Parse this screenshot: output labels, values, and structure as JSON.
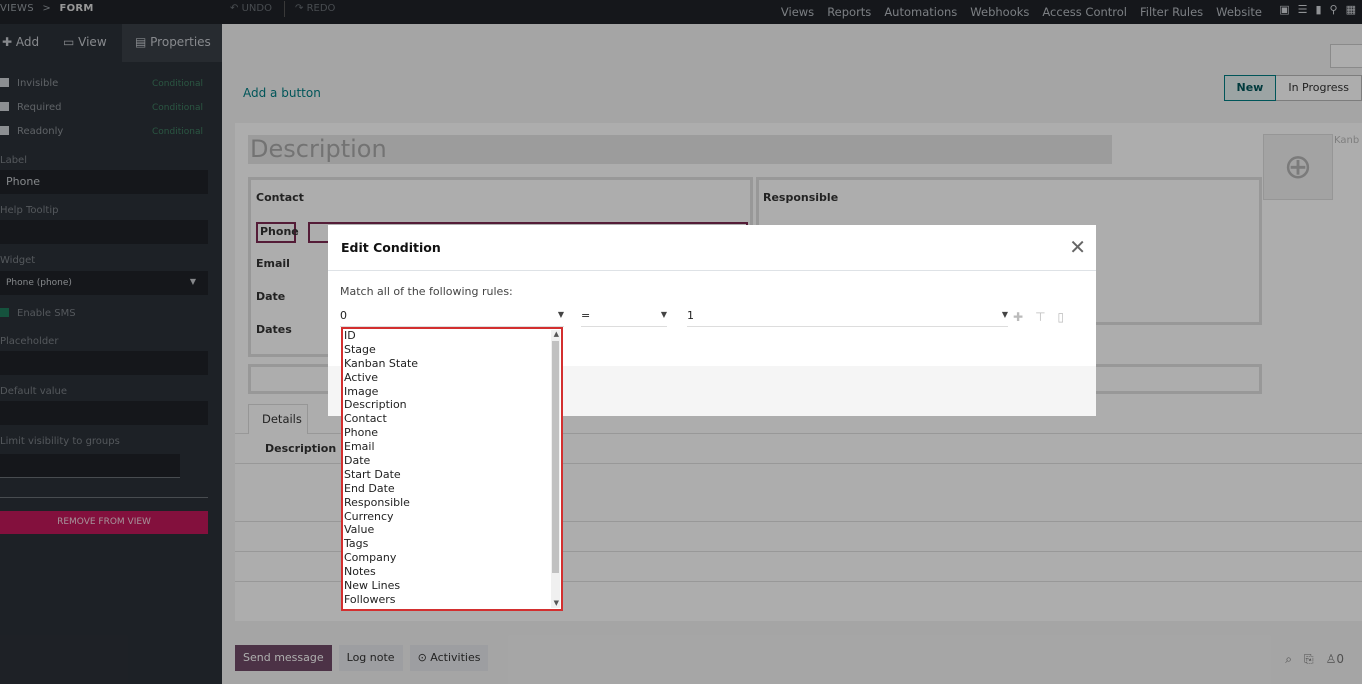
{
  "topbar": {
    "breadcrumb_views": "VIEWS",
    "breadcrumb_sep": ">",
    "breadcrumb_form": "FORM",
    "undo": "UNDO",
    "redo": "REDO",
    "menu": [
      "Views",
      "Reports",
      "Automations",
      "Webhooks",
      "Access Control",
      "Filter Rules",
      "Website"
    ]
  },
  "sidebar": {
    "tabs": {
      "add": "Add",
      "view": "View",
      "properties": "Properties"
    },
    "checks": [
      {
        "label": "Invisible",
        "conditional": "Conditional"
      },
      {
        "label": "Required",
        "conditional": "Conditional"
      },
      {
        "label": "Readonly",
        "conditional": "Conditional"
      }
    ],
    "label_label": "Label",
    "label_value": "Phone",
    "help_tooltip_label": "Help Tooltip",
    "widget_label": "Widget",
    "widget_value": "Phone (phone)",
    "enable_sms": "Enable SMS",
    "placeholder_label": "Placeholder",
    "default_value_label": "Default value",
    "limit_visibility_label": "Limit visibility to groups",
    "remove_button": "REMOVE FROM VIEW"
  },
  "form": {
    "add_button": "Add a button",
    "stages": [
      "New",
      "In Progress"
    ],
    "title_placeholder": "Description",
    "kanban": "Kanb",
    "group1_title": "Contact",
    "group2_title": "Responsible",
    "fields": [
      "Phone",
      "Email",
      "Date",
      "Dates"
    ],
    "notebook_tab": "Details",
    "notebook_desc": "Description"
  },
  "chatter": {
    "send_message": "Send message",
    "log_note": "Log note",
    "activities": "Activities",
    "followers_count": "0"
  },
  "modal": {
    "title": "Edit Condition",
    "match_text": "Match all of the following rules:",
    "field_value": "0",
    "operator_value": "=",
    "value_value": "1"
  },
  "dropdown": {
    "options": [
      "ID",
      "Stage",
      "Kanban State",
      "Active",
      "Image",
      "Description",
      "Contact",
      "Phone",
      "Email",
      "Date",
      "Start Date",
      "End Date",
      "Responsible",
      "Currency",
      "Value",
      "Tags",
      "Company",
      "Notes",
      "New Lines",
      "Followers"
    ]
  },
  "colors": {
    "accent": "#017e84",
    "primary": "#714b67",
    "danger_border": "#d32f2f",
    "remove_bg": "#c2185b"
  }
}
